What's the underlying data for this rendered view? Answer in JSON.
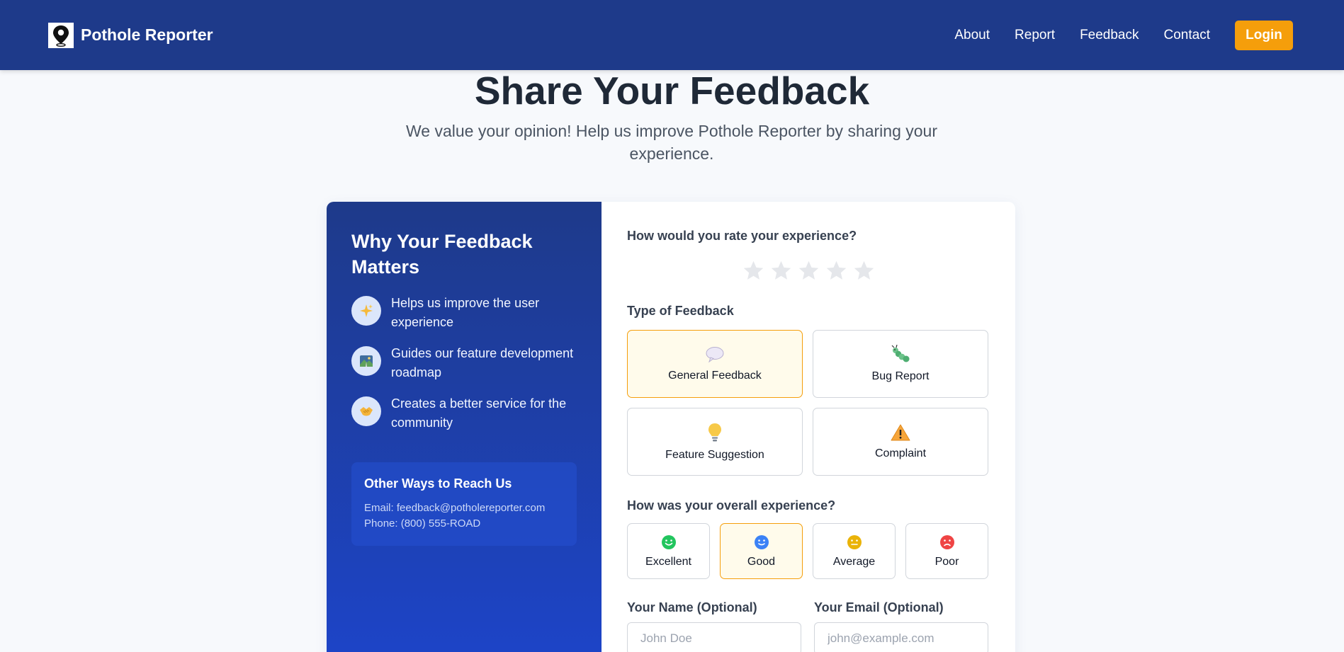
{
  "header": {
    "brand": "Pothole Reporter",
    "nav": [
      "About",
      "Report",
      "Feedback",
      "Contact"
    ],
    "login_label": "Login"
  },
  "hero": {
    "title": "Share Your Feedback",
    "subtitle": "We value your opinion! Help us improve Pothole Reporter by sharing your experience."
  },
  "sidebar": {
    "title": "Why Your Feedback Matters",
    "benefits": [
      {
        "icon": "sparkles-icon",
        "text": "Helps us improve the user experience"
      },
      {
        "icon": "roadmap-icon",
        "text": "Guides our feature development roadmap"
      },
      {
        "icon": "handshake-icon",
        "text": "Creates a better service for the community"
      }
    ],
    "reach": {
      "title": "Other Ways to Reach Us",
      "email": "Email: feedback@potholereporter.com",
      "phone": "Phone: (800) 555-ROAD"
    }
  },
  "form": {
    "rating_label": "How would you rate your experience?",
    "rating_max": 5,
    "rating_value": 0,
    "type_label": "Type of Feedback",
    "types": [
      {
        "label": "General Feedback",
        "icon": "speech-bubble-icon",
        "selected": true
      },
      {
        "label": "Bug Report",
        "icon": "bug-icon",
        "selected": false
      },
      {
        "label": "Feature Suggestion",
        "icon": "lightbulb-icon",
        "selected": false
      },
      {
        "label": "Complaint",
        "icon": "warning-icon",
        "selected": false
      }
    ],
    "experience_label": "How was your overall experience?",
    "experiences": [
      {
        "label": "Excellent",
        "icon": "smile-icon",
        "color": "#22c55e",
        "selected": false
      },
      {
        "label": "Good",
        "icon": "smile-icon",
        "color": "#3b82f6",
        "selected": true
      },
      {
        "label": "Average",
        "icon": "neutral-face-icon",
        "color": "#eab308",
        "selected": false
      },
      {
        "label": "Poor",
        "icon": "frown-icon",
        "color": "#ef4444",
        "selected": false
      }
    ],
    "name_label": "Your Name (Optional)",
    "name_placeholder": "John Doe",
    "email_label": "Your Email (Optional)",
    "email_placeholder": "john@example.com"
  },
  "colors": {
    "primary": "#1e3a8a",
    "accent": "#f59e0b",
    "star_empty": "#e5e7eb"
  }
}
